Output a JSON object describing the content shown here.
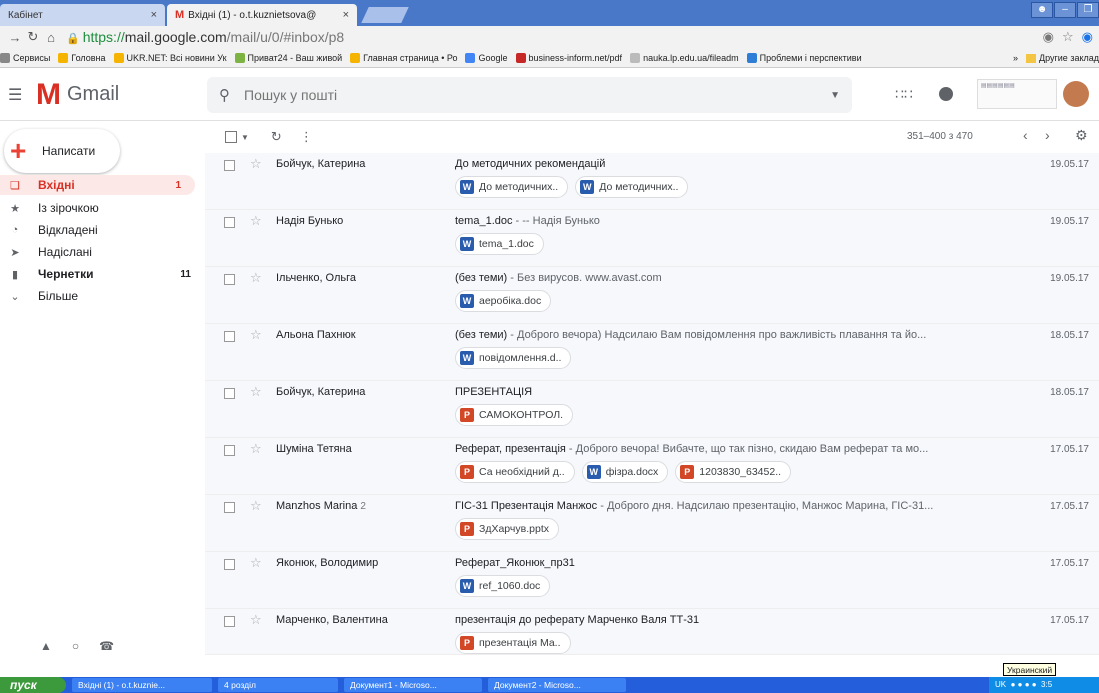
{
  "browser": {
    "tabs": [
      {
        "title": "Кабінет",
        "close": "×"
      },
      {
        "title": "Вхідні (1) - o.t.kuznietsova@",
        "close": "×"
      }
    ],
    "url_https": "https://",
    "url_host": "mail.google.com",
    "url_path": "/mail/u/0/#inbox/p8",
    "bookmarks": [
      {
        "label": "Сервисы",
        "color": "#888888"
      },
      {
        "label": "Головна",
        "color": "#f4b400"
      },
      {
        "label": "UKR.NET: Всі новини Ук",
        "color": "#f4b400"
      },
      {
        "label": "Приват24 - Ваш живой",
        "color": "#7cb342"
      },
      {
        "label": "Главная страница • Ро",
        "color": "#f4b400"
      },
      {
        "label": "Google",
        "color": "#4285f4"
      },
      {
        "label": "business-inform.net/pdf",
        "color": "#c62828"
      },
      {
        "label": "nauka.lp.edu.ua/fileadm",
        "color": "#bbbbbb"
      },
      {
        "label": "Проблеми і перспективи",
        "color": "#2e7dd7"
      }
    ],
    "bookmarks_other": "Другие заклад"
  },
  "gmail": {
    "logo_word": "Gmail",
    "search_placeholder": "Пошук у пошті",
    "compose_label": "Написати",
    "nav": [
      {
        "label": "Вхідні",
        "count": "1",
        "icon": "inbox-icon",
        "active": true
      },
      {
        "label": "Із зірочкою",
        "count": "",
        "icon": "star-icon"
      },
      {
        "label": "Відкладені",
        "count": "",
        "icon": "clock-icon"
      },
      {
        "label": "Надіслані",
        "count": "",
        "icon": "send-icon"
      },
      {
        "label": "Чернетки",
        "count": "11",
        "icon": "draft-icon",
        "bold": true
      },
      {
        "label": "Більше",
        "count": "",
        "icon": "chevron-down-icon"
      }
    ],
    "pager": "351–400 з 470",
    "messages": [
      {
        "sender": "Бойчук, Катерина",
        "count": "",
        "subject": "До методичних рекомендацій",
        "snippet": "",
        "date": "19.05.17",
        "attachments": [
          {
            "type": "W",
            "name": "До методичних.."
          },
          {
            "type": "W",
            "name": "До методичних.."
          }
        ]
      },
      {
        "sender": "Надія Бунько",
        "count": "",
        "subject": "tema_1.doc",
        "snippet": " - -- Надія Бунько",
        "date": "19.05.17",
        "attachments": [
          {
            "type": "W",
            "name": "tema_1.doc"
          }
        ]
      },
      {
        "sender": "Ільченко, Ольга",
        "count": "",
        "subject": "(без теми)",
        "snippet": " - Без вирусов. www.avast.com",
        "date": "19.05.17",
        "attachments": [
          {
            "type": "W",
            "name": "аеробіка.doc"
          }
        ]
      },
      {
        "sender": "Альона Пахнюк",
        "count": "",
        "subject": "(без теми)",
        "snippet": " - Доброго вечора) Надсилаю Вам повідомлення про важливість плавання та йо...",
        "date": "18.05.17",
        "attachments": [
          {
            "type": "W",
            "name": "повідомлення.d.."
          }
        ]
      },
      {
        "sender": "Бойчук, Катерина",
        "count": "",
        "subject": "ПРЕЗЕНТАЦІЯ",
        "snippet": "",
        "date": "18.05.17",
        "attachments": [
          {
            "type": "P",
            "name": "САМОКОНТРОЛ."
          }
        ]
      },
      {
        "sender": "Шуміна Тетяна",
        "count": "",
        "subject": "Реферат, презентація",
        "snippet": " - Доброго вечора! Вибачте, що так пізно, скидаю Вам реферат та мо...",
        "date": "17.05.17",
        "attachments": [
          {
            "type": "P",
            "name": "Са необхідний д.."
          },
          {
            "type": "W",
            "name": "фізра.docx"
          },
          {
            "type": "P",
            "name": "1203830_63452.."
          }
        ]
      },
      {
        "sender": "Manzhos Marina",
        "count": "2",
        "subject": "ГІС-31 Презентація Манжос",
        "snippet": " - Доброго дня. Надсилаю презентацію, Манжос Марина, ГІС-31...",
        "date": "17.05.17",
        "attachments": [
          {
            "type": "P",
            "name": "ЗдХарчув.pptx"
          }
        ]
      },
      {
        "sender": "Яконюк, Володимир",
        "count": "",
        "subject": "Реферат_Яконюк_пр31",
        "snippet": "",
        "date": "17.05.17",
        "attachments": [
          {
            "type": "W",
            "name": "ref_1060.doc"
          }
        ]
      },
      {
        "sender": "Марченко, Валентина",
        "count": "",
        "subject": "презентація до реферату Марченко Валя ТТ-31",
        "snippet": "",
        "date": "17.05.17",
        "attachments": [
          {
            "type": "P",
            "name": "презентація Ма.."
          }
        ]
      }
    ]
  },
  "taskbar": {
    "start": "пуск",
    "tasks": [
      "Вхідні (1) - o.t.kuznie...",
      "4 розділ",
      "Документ1 - Microso...",
      "Документ2 - Microso..."
    ],
    "tray_lang": "UK",
    "tray_time": "3:5",
    "tooltip": "Украинский"
  }
}
